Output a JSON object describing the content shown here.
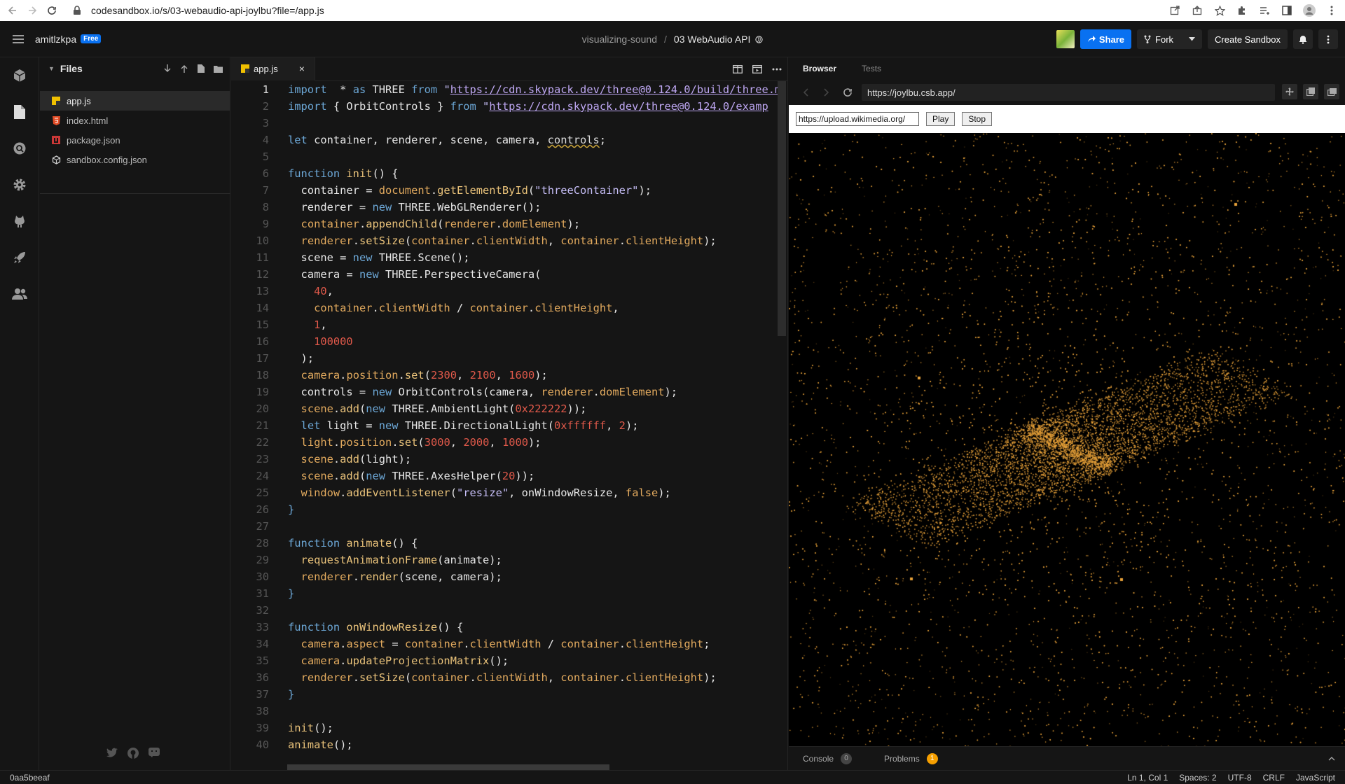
{
  "browser": {
    "url": "codesandbox.io/s/03-webaudio-api-joylbu?file=/app.js"
  },
  "header": {
    "username": "amitlzkpa",
    "plan_badge": "Free",
    "project": "visualizing-sound",
    "separator": "/",
    "sandbox_name": "03 WebAudio API",
    "share_label": "Share",
    "fork_label": "Fork",
    "create_label": "Create Sandbox"
  },
  "files": {
    "title": "Files",
    "items": [
      "app.js",
      "index.html",
      "package.json",
      "sandbox.config.json"
    ]
  },
  "editor": {
    "tab_label": "app.js",
    "close_glyph": "×"
  },
  "preview": {
    "tab_browser": "Browser",
    "tab_tests": "Tests",
    "address": "https://joylbu.csb.app/",
    "audio_url_value": "https://upload.wikimedia.org/",
    "play_label": "Play",
    "stop_label": "Stop",
    "console_label": "Console",
    "console_count": "0",
    "problems_label": "Problems",
    "problems_count": "1"
  },
  "statusbar": {
    "commit": "0aa5beeaf",
    "position": "Ln 1, Col 1",
    "spaces": "Spaces: 2",
    "encoding": "UTF-8",
    "eol": "CRLF",
    "language": "JavaScript"
  },
  "colors": {
    "accent": "#0971f1",
    "particle": "#e8a23a",
    "problems_badge": "#f59f00"
  },
  "code_lines": [
    [
      [
        "kw",
        "import"
      ],
      [
        "",
        "  * "
      ],
      [
        "kw",
        "as"
      ],
      [
        "cl",
        " THREE "
      ],
      [
        "kw",
        "from"
      ],
      [
        "st",
        " \""
      ],
      [
        "url",
        "https://cdn.skypack.dev/three@0.124.0/build/three.m"
      ]
    ],
    [
      [
        "kw",
        "import"
      ],
      [
        "",
        ""
      ],
      [
        "cl",
        " { OrbitControls } "
      ],
      [
        "kw",
        "from"
      ],
      [
        "st",
        " \""
      ],
      [
        "url",
        "https://cdn.skypack.dev/three@0.124.0/examp"
      ]
    ],
    [],
    [
      [
        "kw",
        "let"
      ],
      [
        "cl",
        " container, renderer, scene, camera, "
      ],
      [
        "wavy",
        "controls"
      ],
      [
        "cl",
        ";"
      ]
    ],
    [],
    [
      [
        "kw",
        "function"
      ],
      [
        "fn",
        " init"
      ],
      [
        "cl",
        "() {"
      ]
    ],
    [
      [
        "cl",
        "  container = "
      ],
      [
        "pr",
        "document"
      ],
      [
        "cl",
        "."
      ],
      [
        "fn",
        "getElementById"
      ],
      [
        "cl",
        "("
      ],
      [
        "st",
        "\"threeContainer\""
      ],
      [
        "cl",
        ");"
      ]
    ],
    [
      [
        "cl",
        "  renderer = "
      ],
      [
        "kw",
        "new"
      ],
      [
        "cl",
        " THREE.WebGLRenderer();"
      ]
    ],
    [
      [
        "cl",
        "  "
      ],
      [
        "pr",
        "container"
      ],
      [
        "cl",
        "."
      ],
      [
        "fn",
        "appendChild"
      ],
      [
        "cl",
        "("
      ],
      [
        "pr",
        "renderer"
      ],
      [
        "cl",
        "."
      ],
      [
        "pr",
        "domElement"
      ],
      [
        "cl",
        ");"
      ]
    ],
    [
      [
        "cl",
        "  "
      ],
      [
        "pr",
        "renderer"
      ],
      [
        "cl",
        "."
      ],
      [
        "fn",
        "setSize"
      ],
      [
        "cl",
        "("
      ],
      [
        "pr",
        "container"
      ],
      [
        "cl",
        "."
      ],
      [
        "pr",
        "clientWidth"
      ],
      [
        "cl",
        ", "
      ],
      [
        "pr",
        "container"
      ],
      [
        "cl",
        "."
      ],
      [
        "pr",
        "clientHeight"
      ],
      [
        "cl",
        ");"
      ]
    ],
    [
      [
        "cl",
        "  scene = "
      ],
      [
        "kw",
        "new"
      ],
      [
        "cl",
        " THREE.Scene();"
      ]
    ],
    [
      [
        "cl",
        "  camera = "
      ],
      [
        "kw",
        "new"
      ],
      [
        "cl",
        " THREE.PerspectiveCamera("
      ]
    ],
    [
      [
        "nm",
        "    40"
      ],
      [
        "cl",
        ","
      ]
    ],
    [
      [
        "cl",
        "    "
      ],
      [
        "pr",
        "container"
      ],
      [
        "cl",
        "."
      ],
      [
        "pr",
        "clientWidth"
      ],
      [
        "cl",
        " / "
      ],
      [
        "pr",
        "container"
      ],
      [
        "cl",
        "."
      ],
      [
        "pr",
        "clientHeight"
      ],
      [
        "cl",
        ","
      ]
    ],
    [
      [
        "nm",
        "    1"
      ],
      [
        "cl",
        ","
      ]
    ],
    [
      [
        "nm",
        "    100000"
      ]
    ],
    [
      [
        "cl",
        "  );"
      ]
    ],
    [
      [
        "cl",
        "  "
      ],
      [
        "pr",
        "camera"
      ],
      [
        "cl",
        "."
      ],
      [
        "pr",
        "position"
      ],
      [
        "cl",
        "."
      ],
      [
        "fn",
        "set"
      ],
      [
        "cl",
        "("
      ],
      [
        "nm",
        "2300"
      ],
      [
        "cl",
        ", "
      ],
      [
        "nm",
        "2100"
      ],
      [
        "cl",
        ", "
      ],
      [
        "nm",
        "1600"
      ],
      [
        "cl",
        ");"
      ]
    ],
    [
      [
        "cl",
        "  controls = "
      ],
      [
        "kw",
        "new"
      ],
      [
        "cl",
        " OrbitControls(camera, "
      ],
      [
        "pr",
        "renderer"
      ],
      [
        "cl",
        "."
      ],
      [
        "pr",
        "domElement"
      ],
      [
        "cl",
        ");"
      ]
    ],
    [
      [
        "cl",
        "  "
      ],
      [
        "pr",
        "scene"
      ],
      [
        "cl",
        "."
      ],
      [
        "fn",
        "add"
      ],
      [
        "cl",
        "("
      ],
      [
        "kw",
        "new"
      ],
      [
        "cl",
        " THREE.AmbientLight("
      ],
      [
        "nm",
        "0x222222"
      ],
      [
        "cl",
        "));"
      ]
    ],
    [
      [
        "cl",
        "  "
      ],
      [
        "kw",
        "let"
      ],
      [
        "cl",
        " light = "
      ],
      [
        "kw",
        "new"
      ],
      [
        "cl",
        " THREE.DirectionalLight("
      ],
      [
        "nm",
        "0xffffff"
      ],
      [
        "cl",
        ", "
      ],
      [
        "nm",
        "2"
      ],
      [
        "cl",
        ");"
      ]
    ],
    [
      [
        "cl",
        "  "
      ],
      [
        "pr",
        "light"
      ],
      [
        "cl",
        "."
      ],
      [
        "pr",
        "position"
      ],
      [
        "cl",
        "."
      ],
      [
        "fn",
        "set"
      ],
      [
        "cl",
        "("
      ],
      [
        "nm",
        "3000"
      ],
      [
        "cl",
        ", "
      ],
      [
        "nm",
        "2000"
      ],
      [
        "cl",
        ", "
      ],
      [
        "nm",
        "1000"
      ],
      [
        "cl",
        ");"
      ]
    ],
    [
      [
        "cl",
        "  "
      ],
      [
        "pr",
        "scene"
      ],
      [
        "cl",
        "."
      ],
      [
        "fn",
        "add"
      ],
      [
        "cl",
        "(light);"
      ]
    ],
    [
      [
        "cl",
        "  "
      ],
      [
        "pr",
        "scene"
      ],
      [
        "cl",
        "."
      ],
      [
        "fn",
        "add"
      ],
      [
        "cl",
        "("
      ],
      [
        "kw",
        "new"
      ],
      [
        "cl",
        " THREE.AxesHelper("
      ],
      [
        "nm",
        "20"
      ],
      [
        "cl",
        "));"
      ]
    ],
    [
      [
        "cl",
        "  "
      ],
      [
        "pr",
        "window"
      ],
      [
        "cl",
        "."
      ],
      [
        "fn",
        "addEventListener"
      ],
      [
        "cl",
        "("
      ],
      [
        "st",
        "\"resize\""
      ],
      [
        "cl",
        ", onWindowResize, "
      ],
      [
        "bool",
        "false"
      ],
      [
        "cl",
        ");"
      ]
    ],
    [
      [
        "kw",
        "}"
      ]
    ],
    [],
    [
      [
        "kw",
        "function"
      ],
      [
        "fn",
        " animate"
      ],
      [
        "cl",
        "() {"
      ]
    ],
    [
      [
        "cl",
        "  "
      ],
      [
        "fn",
        "requestAnimationFrame"
      ],
      [
        "cl",
        "(animate);"
      ]
    ],
    [
      [
        "cl",
        "  "
      ],
      [
        "pr",
        "renderer"
      ],
      [
        "cl",
        "."
      ],
      [
        "fn",
        "render"
      ],
      [
        "cl",
        "(scene, camera);"
      ]
    ],
    [
      [
        "kw",
        "}"
      ]
    ],
    [],
    [
      [
        "kw",
        "function"
      ],
      [
        "fn",
        " onWindowResize"
      ],
      [
        "cl",
        "() {"
      ]
    ],
    [
      [
        "cl",
        "  "
      ],
      [
        "pr",
        "camera"
      ],
      [
        "cl",
        "."
      ],
      [
        "pr",
        "aspect"
      ],
      [
        "cl",
        " = "
      ],
      [
        "pr",
        "container"
      ],
      [
        "cl",
        "."
      ],
      [
        "pr",
        "clientWidth"
      ],
      [
        "cl",
        " / "
      ],
      [
        "pr",
        "container"
      ],
      [
        "cl",
        "."
      ],
      [
        "pr",
        "clientHeight"
      ],
      [
        "cl",
        ";"
      ]
    ],
    [
      [
        "cl",
        "  "
      ],
      [
        "pr",
        "camera"
      ],
      [
        "cl",
        "."
      ],
      [
        "fn",
        "updateProjectionMatrix"
      ],
      [
        "cl",
        "();"
      ]
    ],
    [
      [
        "cl",
        "  "
      ],
      [
        "pr",
        "renderer"
      ],
      [
        "cl",
        "."
      ],
      [
        "fn",
        "setSize"
      ],
      [
        "cl",
        "("
      ],
      [
        "pr",
        "container"
      ],
      [
        "cl",
        "."
      ],
      [
        "pr",
        "clientWidth"
      ],
      [
        "cl",
        ", "
      ],
      [
        "pr",
        "container"
      ],
      [
        "cl",
        "."
      ],
      [
        "pr",
        "clientHeight"
      ],
      [
        "cl",
        ");"
      ]
    ],
    [
      [
        "kw",
        "}"
      ]
    ],
    [],
    [
      [
        "fn",
        "init"
      ],
      [
        "cl",
        "();"
      ]
    ],
    [
      [
        "fn",
        "animate"
      ],
      [
        "cl",
        "();"
      ]
    ],
    []
  ]
}
